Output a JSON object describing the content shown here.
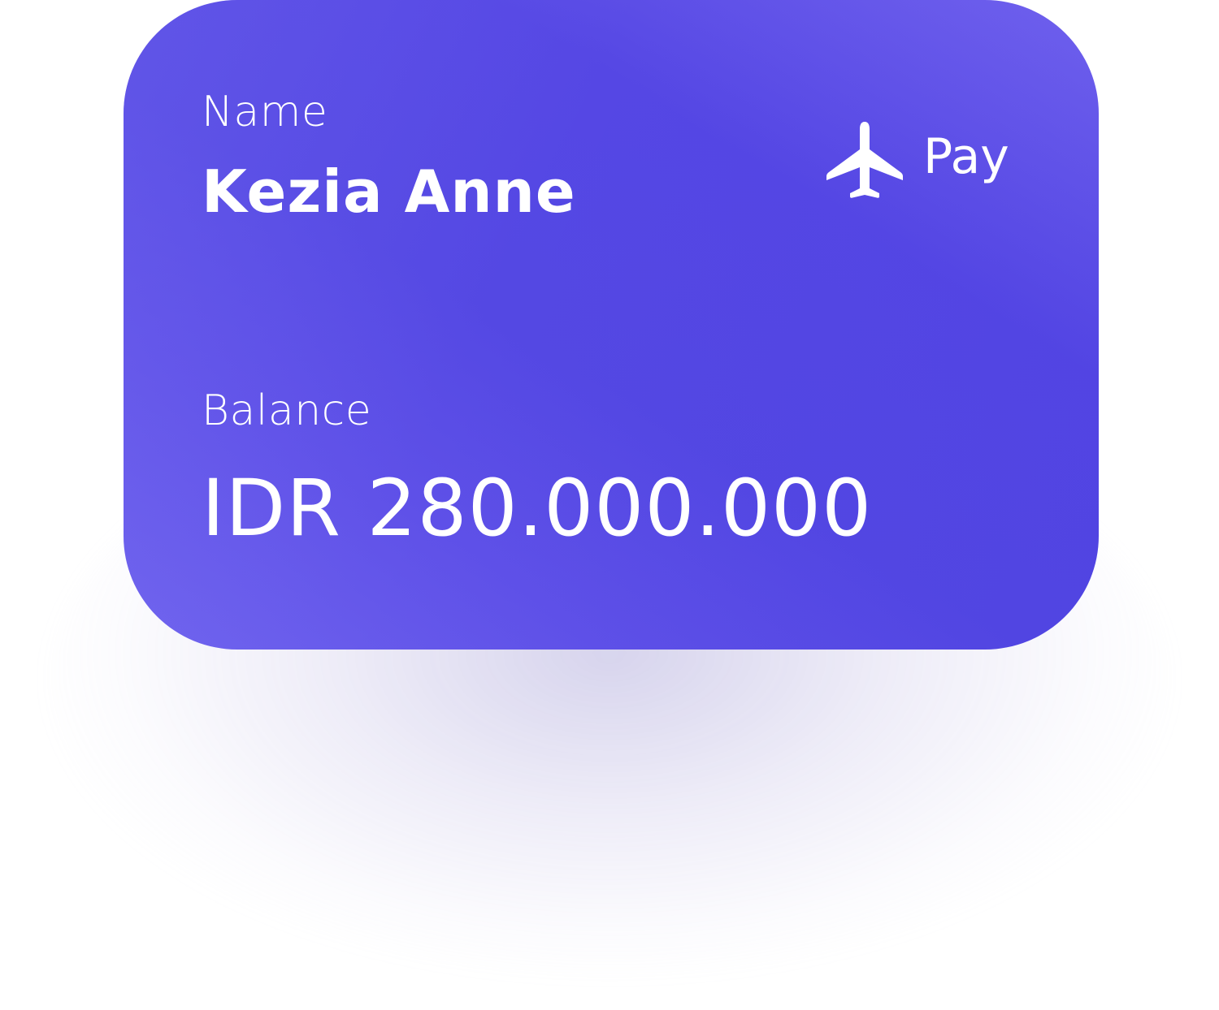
{
  "card": {
    "name_label": "Name",
    "name_value": "Kezia Anne",
    "balance_label": "Balance",
    "balance_value": "IDR 280.000.000",
    "brand_text": "Pay",
    "brand_icon": "airplane-icon"
  },
  "colors": {
    "card_primary": "#5547e4",
    "card_light": "#7465ef",
    "text": "#ffffff"
  }
}
